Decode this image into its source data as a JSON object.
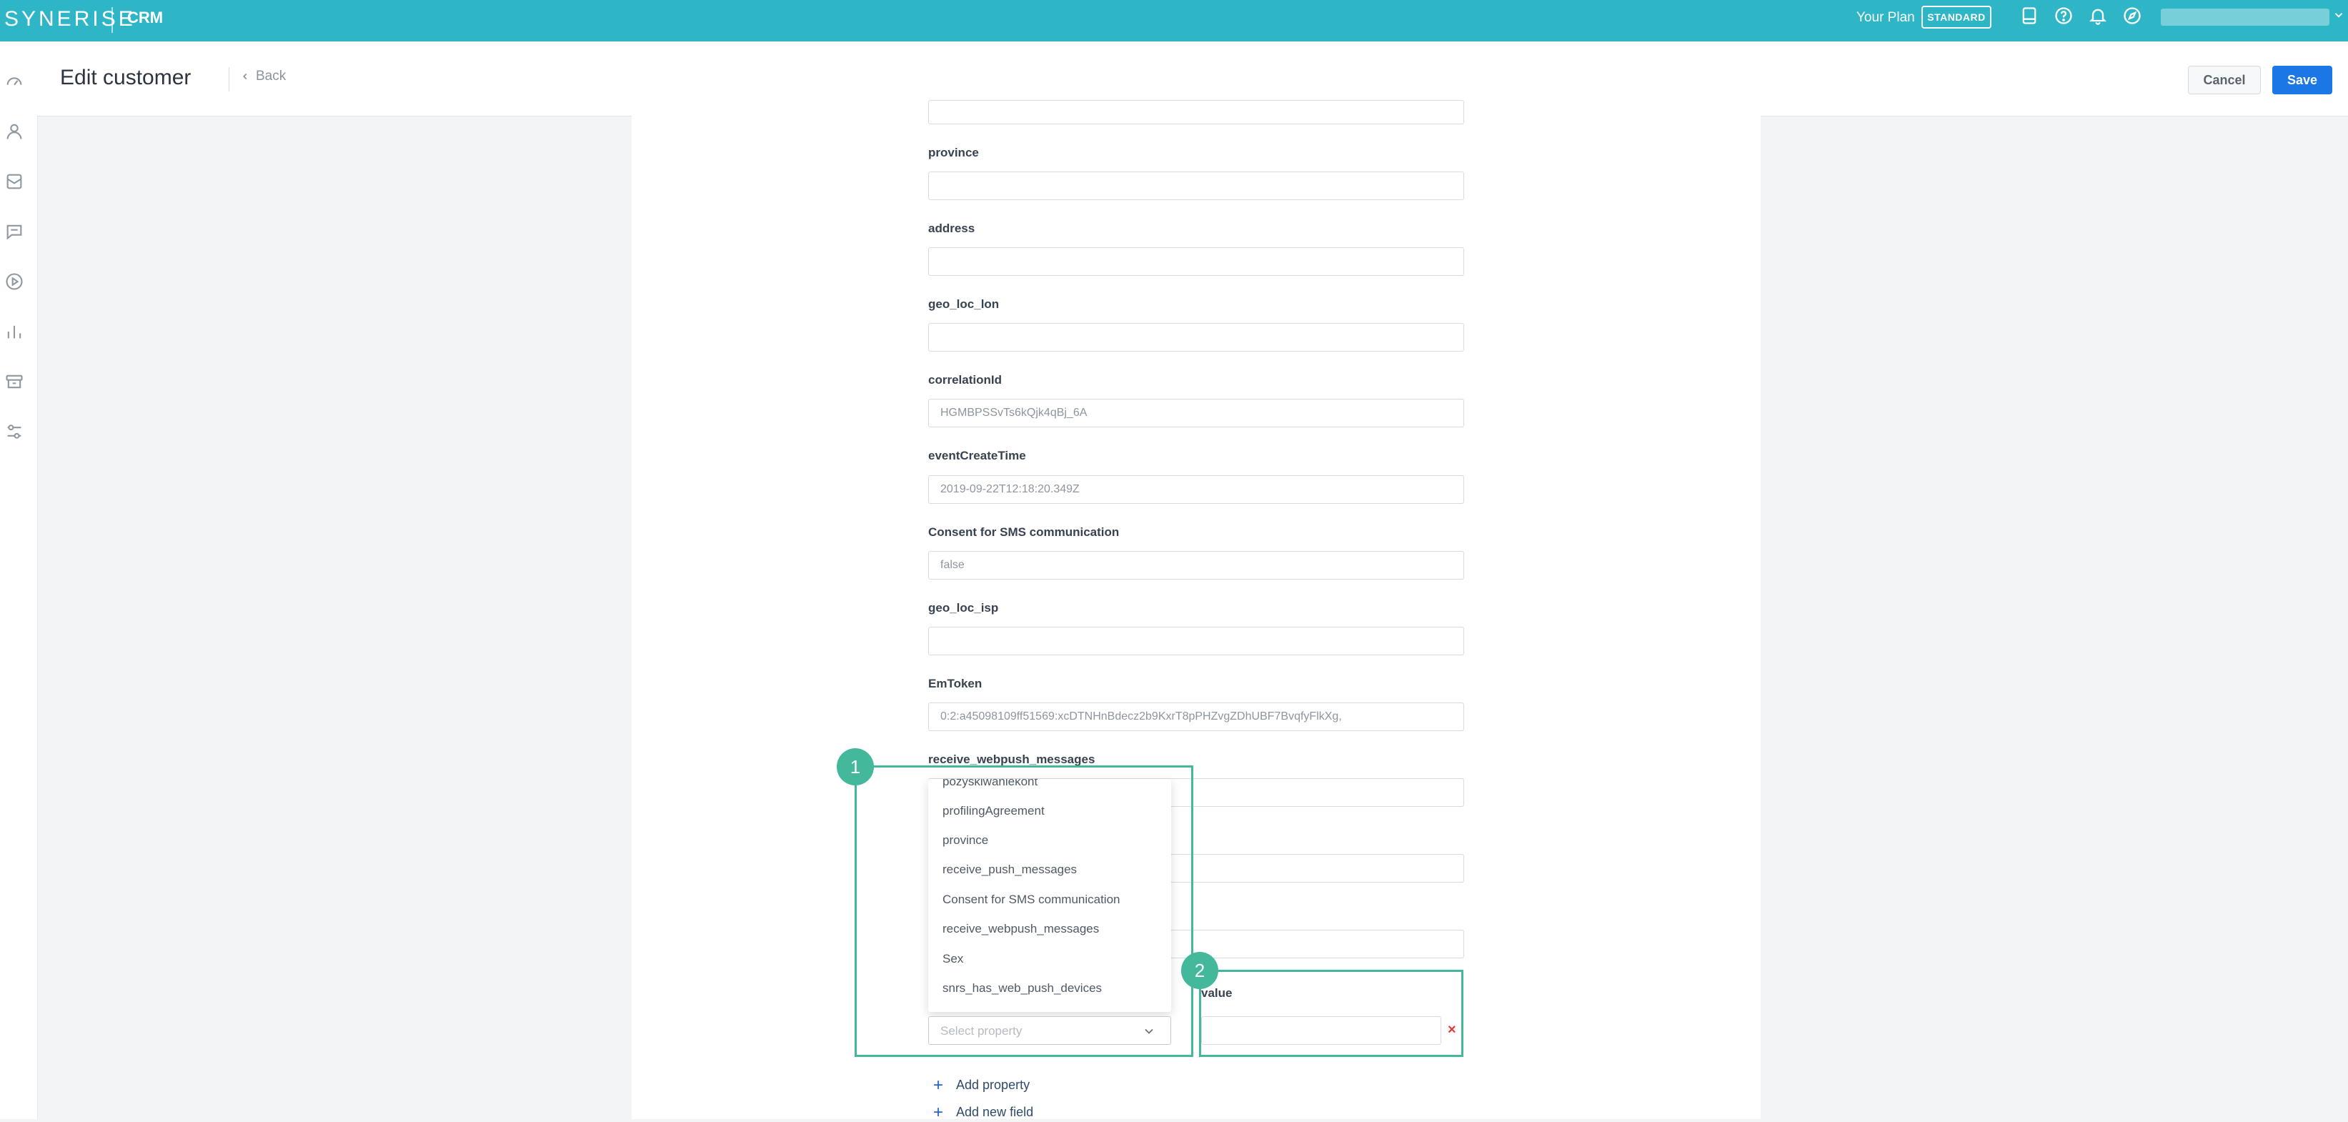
{
  "topbar": {
    "logo": "SYNERISE",
    "app": "CRM",
    "plan_label": "Your Plan",
    "plan_badge": "STANDARD",
    "icons": [
      "book-icon",
      "help-icon",
      "bell-icon",
      "compass-icon"
    ]
  },
  "nav": {
    "icons": [
      "dashboard-icon",
      "profile-icon",
      "inbox-icon",
      "chat-icon",
      "play-icon",
      "analytics-icon",
      "archive-icon",
      "settings-sliders-icon"
    ]
  },
  "header": {
    "title": "Edit customer",
    "back": "Back",
    "cancel": "Cancel",
    "save": "Save"
  },
  "form": {
    "fields": [
      {
        "label": "province",
        "value": ""
      },
      {
        "label": "address",
        "value": ""
      },
      {
        "label": "geo_loc_lon",
        "value": ""
      },
      {
        "label": "correlationId",
        "value": "HGMBPSSvTs6kQjk4qBj_6A"
      },
      {
        "label": "eventCreateTime",
        "value": "2019-09-22T12:18:20.349Z"
      },
      {
        "label": "Consent for SMS communication",
        "value": "false"
      },
      {
        "label": "geo_loc_isp",
        "value": ""
      },
      {
        "label": "EmToken",
        "value": "0:2:a45098109ff51569:xcDTNHnBdecz2b9KxrT8pPHZvgZDhUBF7BvqfyFlkXg,"
      },
      {
        "label": "receive_webpush_messages",
        "value": ""
      }
    ],
    "dropdown": {
      "options": [
        "pozyskiwaniekont",
        "profilingAgreement",
        "province",
        "receive_push_messages",
        "Consent for SMS communication",
        "receive_webpush_messages",
        "Sex",
        "snrs_has_web_push_devices"
      ],
      "placeholder": "Select property"
    },
    "value_label": "value",
    "remove": "×",
    "add_property": "Add property",
    "add_field": "Add new field"
  },
  "callouts": [
    "1",
    "2"
  ],
  "colors": {
    "topbar": "#2fb6c6",
    "primary": "#1b76e6",
    "callout": "#43b89a",
    "remove": "#e53935"
  }
}
